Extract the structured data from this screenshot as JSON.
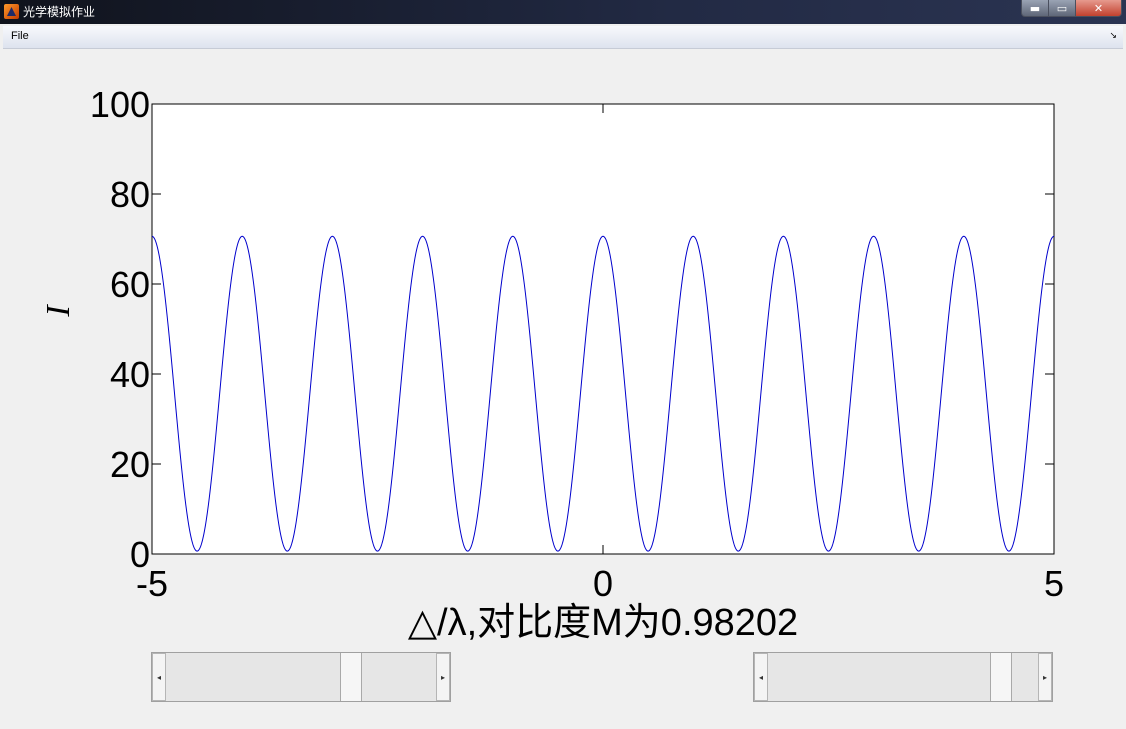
{
  "window": {
    "title": "光学模拟作业",
    "controls": {
      "minimize": "▬",
      "maximize": "▭",
      "close": "✕"
    }
  },
  "menu": {
    "file": "File",
    "dock": "↘"
  },
  "sliders": [
    {
      "name": "left",
      "value_fraction": 0.72
    },
    {
      "name": "right",
      "value_fraction": 0.86
    }
  ],
  "chart_data": {
    "type": "line",
    "title": "",
    "xlabel": "△/λ,对比度M为0.98202",
    "ylabel": "I",
    "xlim": [
      -5,
      5
    ],
    "ylim": [
      0,
      100
    ],
    "xticks": [
      -5,
      0,
      5
    ],
    "yticks": [
      0,
      20,
      40,
      60,
      80,
      100
    ],
    "grid": false,
    "series": [
      {
        "color": "#0000cc",
        "function": "I = (Imax+Imin)/2 + (Imax-Imin)/2 * cos(2*pi*x)",
        "Imax": 70.6,
        "Imin": 0.64,
        "period": 1,
        "x": [
          -5,
          5
        ]
      }
    ]
  }
}
